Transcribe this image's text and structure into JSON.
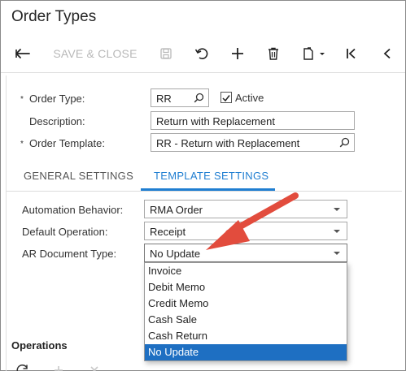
{
  "window": {
    "title": "Order Types"
  },
  "toolbar": {
    "save_close_label": "SAVE & CLOSE",
    "icons": [
      "back-arrow-icon",
      "save-icon",
      "undo-icon",
      "add-icon",
      "delete-icon",
      "copy-paste-icon",
      "first-record-icon",
      "previous-record-icon"
    ]
  },
  "form": {
    "order_type_label": "Order Type:",
    "order_type_value": "RR",
    "active_label": "Active",
    "active_checked": true,
    "description_label": "Description:",
    "description_value": "Return with Replacement",
    "order_template_label": "Order Template:",
    "order_template_value": "RR - Return with Replacement",
    "required_marker": "*"
  },
  "tabs": [
    {
      "label": "GENERAL SETTINGS",
      "active": false
    },
    {
      "label": "TEMPLATE SETTINGS",
      "active": true
    }
  ],
  "template_settings": {
    "automation_behavior_label": "Automation Behavior:",
    "automation_behavior_value": "RMA Order",
    "default_operation_label": "Default Operation:",
    "default_operation_value": "Receipt",
    "ar_document_type_label": "AR Document Type:",
    "ar_document_type_value": "No Update"
  },
  "dropdown": {
    "options": [
      "Invoice",
      "Debit Memo",
      "Credit Memo",
      "Cash Sale",
      "Cash Return",
      "No Update"
    ],
    "selected": "No Update"
  },
  "operations": {
    "title": "Operations"
  },
  "colors": {
    "accent": "#1f7ed1",
    "selected_option": "#1e6fc2",
    "arrow": "#e24c3d"
  }
}
